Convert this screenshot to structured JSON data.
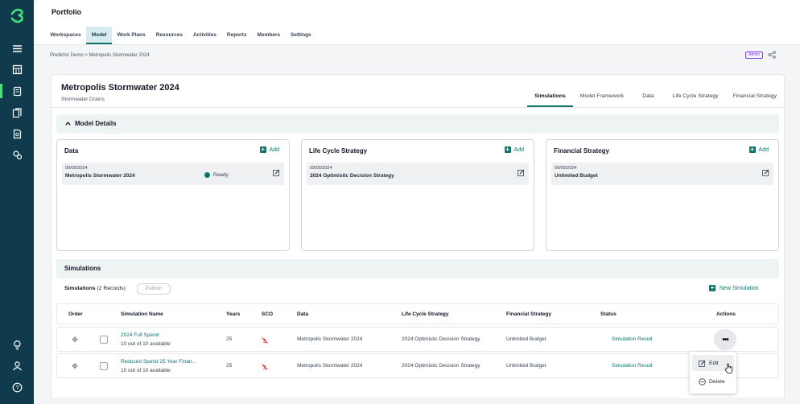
{
  "app": {
    "title": "Portfolio"
  },
  "nav_tabs": [
    "Workspaces",
    "Model",
    "Work Plans",
    "Resources",
    "Activities",
    "Reports",
    "Members",
    "Settings"
  ],
  "breadcrumb": "Predictor Demo > Metropolis Stormwater 2024",
  "badge": "Admin",
  "model": {
    "title": "Metropolis Stormwater 2024",
    "subtitle": "Stormwater Drains",
    "tabs": [
      "Simulations",
      "Model Framework",
      "Data",
      "Life Cycle Strategy",
      "Financial Strategy"
    ]
  },
  "model_details": {
    "title": "Model Details",
    "add_label": "Add",
    "panels": [
      {
        "title": "Data",
        "date": "09/05/2024",
        "name": "Metropolis Stormwater 2024",
        "status": "Ready"
      },
      {
        "title": "Life Cycle Strategy",
        "date": "09/05/2024",
        "name": "2024 Optimistic Decision Strategy"
      },
      {
        "title": "Financial Strategy",
        "date": "09/05/2024",
        "name": "Unlimited Budget"
      }
    ]
  },
  "simulations": {
    "title": "Simulations",
    "records_label": "Simulations",
    "records_count": "(2 Records)",
    "publish": "Publish",
    "new_simulation": "New Simulation",
    "columns": [
      "Order",
      "Simulation Name",
      "Years",
      "SCO",
      "Data",
      "Life Cycle Strategy",
      "Financial Strategy",
      "Status",
      "Actions"
    ],
    "rows": [
      {
        "name": "2024 Full Spend",
        "sub": "10 out of 10 available",
        "years": "25",
        "data": "Metropolis Stormwater 2024",
        "lcs": "2024 Optimistic Decision Strategy",
        "fs": "Unlimited Budget",
        "status": "Simulation Result"
      },
      {
        "name": "Reduced Spend 25 Year Finan...",
        "sub": "10 out of 10 available",
        "years": "25",
        "data": "Metropolis Stormwater 2024",
        "lcs": "2024 Optimistic Decision Strategy",
        "fs": "Unlimited Budget",
        "status": "Simulation Result"
      }
    ]
  },
  "context_menu": {
    "edit": "Edit",
    "delete": "Delete"
  },
  "colors": {
    "sidebar": "#0f3b4d",
    "accent": "#0f766e",
    "brand_green": "#4ade80"
  }
}
